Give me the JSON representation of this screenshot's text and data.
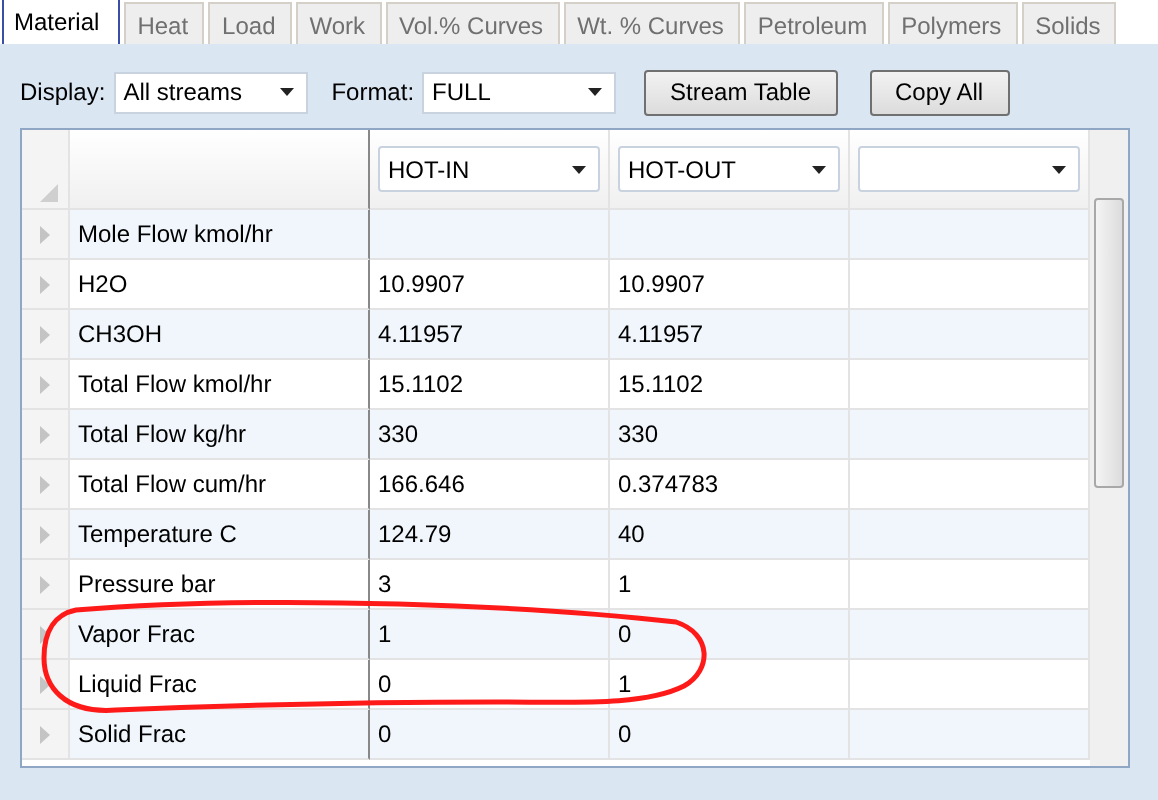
{
  "tabs": [
    {
      "label": "Material",
      "selected": true
    },
    {
      "label": "Heat",
      "selected": false
    },
    {
      "label": "Load",
      "selected": false
    },
    {
      "label": "Work",
      "selected": false
    },
    {
      "label": "Vol.% Curves",
      "selected": false
    },
    {
      "label": "Wt. % Curves",
      "selected": false
    },
    {
      "label": "Petroleum",
      "selected": false
    },
    {
      "label": "Polymers",
      "selected": false
    },
    {
      "label": "Solids",
      "selected": false
    }
  ],
  "toolbar": {
    "display": {
      "label": "Display:",
      "value": "All streams"
    },
    "format": {
      "label": "Format:",
      "value": "FULL"
    },
    "buttons": [
      "Stream Table",
      "Copy All"
    ]
  },
  "grid": {
    "columns": [
      {
        "kind": "stream-select",
        "value": "HOT-IN"
      },
      {
        "kind": "stream-select",
        "value": "HOT-OUT"
      },
      {
        "kind": "stream-select"
      }
    ],
    "rows": [
      {
        "label": "Mole Flow kmol/hr",
        "cells": []
      },
      {
        "label": "H2O",
        "cells": [
          "10.9907",
          "10.9907"
        ]
      },
      {
        "label": "CH3OH",
        "cells": [
          "4.11957",
          "4.11957"
        ]
      },
      {
        "label": "Total Flow kmol/hr",
        "cells": [
          "15.1102",
          "15.1102"
        ]
      },
      {
        "label": "Total Flow kg/hr",
        "cells": [
          "330",
          "330"
        ]
      },
      {
        "label": "Total Flow cum/hr",
        "cells": [
          "166.646",
          "0.374783"
        ]
      },
      {
        "label": "Temperature C",
        "cells": [
          "124.79",
          "40"
        ]
      },
      {
        "label": "Pressure bar",
        "cells": [
          "3",
          "1"
        ]
      },
      {
        "label": "Vapor Frac",
        "cells": [
          "1",
          "0"
        ]
      },
      {
        "label": "Liquid Frac",
        "cells": [
          "0",
          "1"
        ]
      },
      {
        "label": "Solid Frac",
        "cells": [
          "0",
          "0"
        ]
      }
    ]
  }
}
